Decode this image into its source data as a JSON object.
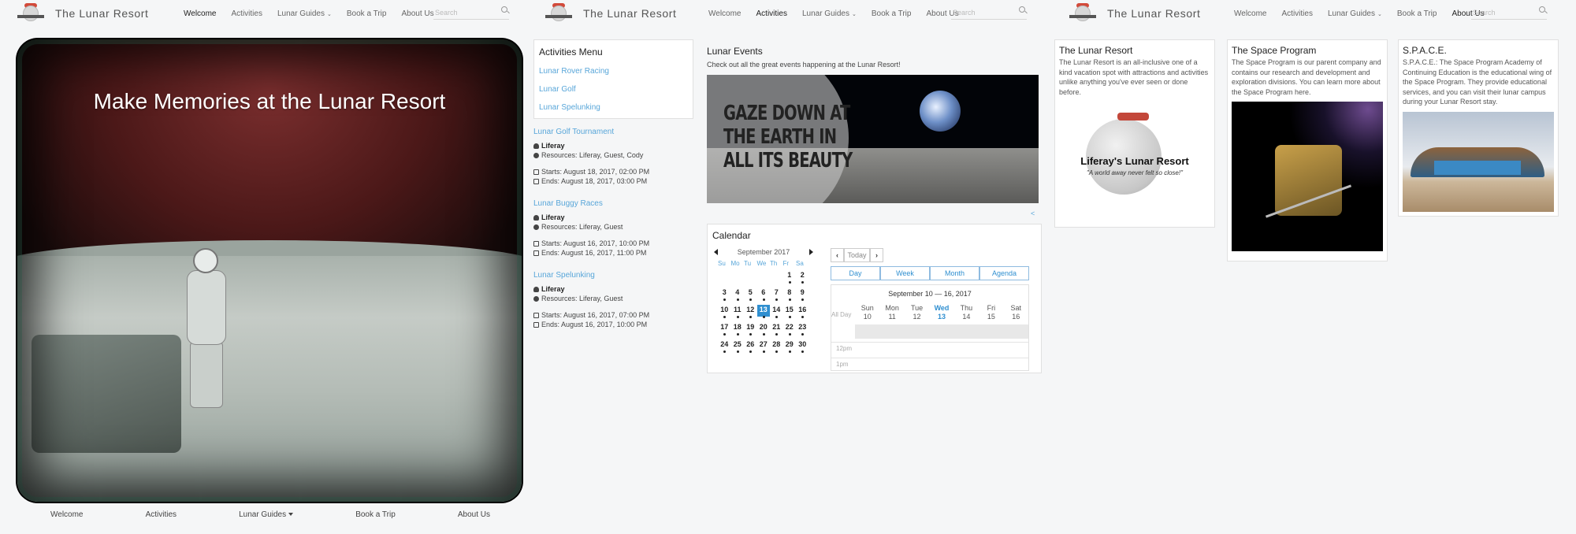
{
  "site": {
    "title": "The Lunar Resort",
    "search_placeholder": "Search"
  },
  "nav": {
    "welcome": "Welcome",
    "activities": "Activities",
    "lunar_guides": "Lunar Guides",
    "book_a_trip": "Book a Trip",
    "about_us": "About Us"
  },
  "welcome_page": {
    "active_tab": "Welcome",
    "hero_title": "Make Memories at the Lunar Resort",
    "footer_nav": [
      "Welcome",
      "Activities",
      "Lunar Guides",
      "Book a Trip",
      "About Us"
    ]
  },
  "activities_page": {
    "active_tab": "Activities",
    "menu_title": "Activities Menu",
    "menu_links": [
      "Lunar Rover Racing",
      "Lunar Golf",
      "Lunar Spelunking"
    ],
    "events": [
      {
        "title": "Lunar Golf Tournament",
        "user": "Liferay",
        "resources": "Resources: Liferay, Guest, Cody",
        "starts": "Starts: August 18, 2017, 02:00 PM",
        "ends": "Ends: August 18, 2017, 03:00 PM"
      },
      {
        "title": "Lunar Buggy Races",
        "user": "Liferay",
        "resources": "Resources: Liferay, Guest",
        "starts": "Starts: August 16, 2017, 10:00 PM",
        "ends": "Ends: August 16, 2017, 11:00 PM"
      },
      {
        "title": "Lunar Spelunking",
        "user": "Liferay",
        "resources": "Resources: Liferay, Guest",
        "starts": "Starts: August 16, 2017, 07:00 PM",
        "ends": "Ends: August 16, 2017, 10:00 PM"
      }
    ],
    "lunar_events_title": "Lunar Events",
    "lunar_events_desc": "Check out all the great events happening at the Lunar Resort!",
    "banner_text": "GAZE DOWN AT THE EARTH IN ALL ITS BEAUTY",
    "share_icon": "share-icon",
    "calendar": {
      "title": "Calendar",
      "month_label": "September 2017",
      "dow": [
        "Su",
        "Mo",
        "Tu",
        "We",
        "Th",
        "Fr",
        "Sa"
      ],
      "days": [
        "",
        "",
        "",
        "",
        "",
        "1",
        "2",
        "3",
        "4",
        "5",
        "6",
        "7",
        "8",
        "9",
        "10",
        "11",
        "12",
        "13",
        "14",
        "15",
        "16",
        "17",
        "18",
        "19",
        "20",
        "21",
        "22",
        "23",
        "24",
        "25",
        "26",
        "27",
        "28",
        "29",
        "30"
      ],
      "selected_day": "13",
      "today_label": "Today",
      "views": [
        "Day",
        "Week",
        "Month",
        "Agenda"
      ],
      "week_range": "September 10 — 16, 2017",
      "all_day_label": "All Day",
      "week_days": [
        {
          "name": "Sun",
          "num": "10"
        },
        {
          "name": "Mon",
          "num": "11"
        },
        {
          "name": "Tue",
          "num": "12"
        },
        {
          "name": "Wed",
          "num": "13"
        },
        {
          "name": "Thu",
          "num": "14"
        },
        {
          "name": "Fri",
          "num": "15"
        },
        {
          "name": "Sat",
          "num": "16"
        }
      ],
      "times": [
        "12pm",
        "1pm"
      ]
    }
  },
  "about_page": {
    "active_tab": "About Us",
    "cards": [
      {
        "title": "The Lunar Resort",
        "text": "The Lunar Resort is an all-inclusive one of a kind vacation spot with attractions and activities unlike anything you've ever seen or done before.",
        "logo_name": "Liferay's Lunar Resort",
        "logo_tag": "\"A world away never felt so close!\""
      },
      {
        "title": "The Space Program",
        "text": "The Space Program is our parent company and contains our research and development and exploration divisions. You can learn more about the Space Program here."
      },
      {
        "title": "S.P.A.C.E.",
        "text": "S.P.A.C.E.: The Space Program Academy of Continuing Education is the educational wing of the Space Program. They provide educational services, and you can visit their lunar campus during your Lunar Resort stay."
      }
    ]
  },
  "colors": {
    "link": "#58a6d9",
    "selected": "#2f8fd0",
    "logo_red": "#d24a3a"
  }
}
